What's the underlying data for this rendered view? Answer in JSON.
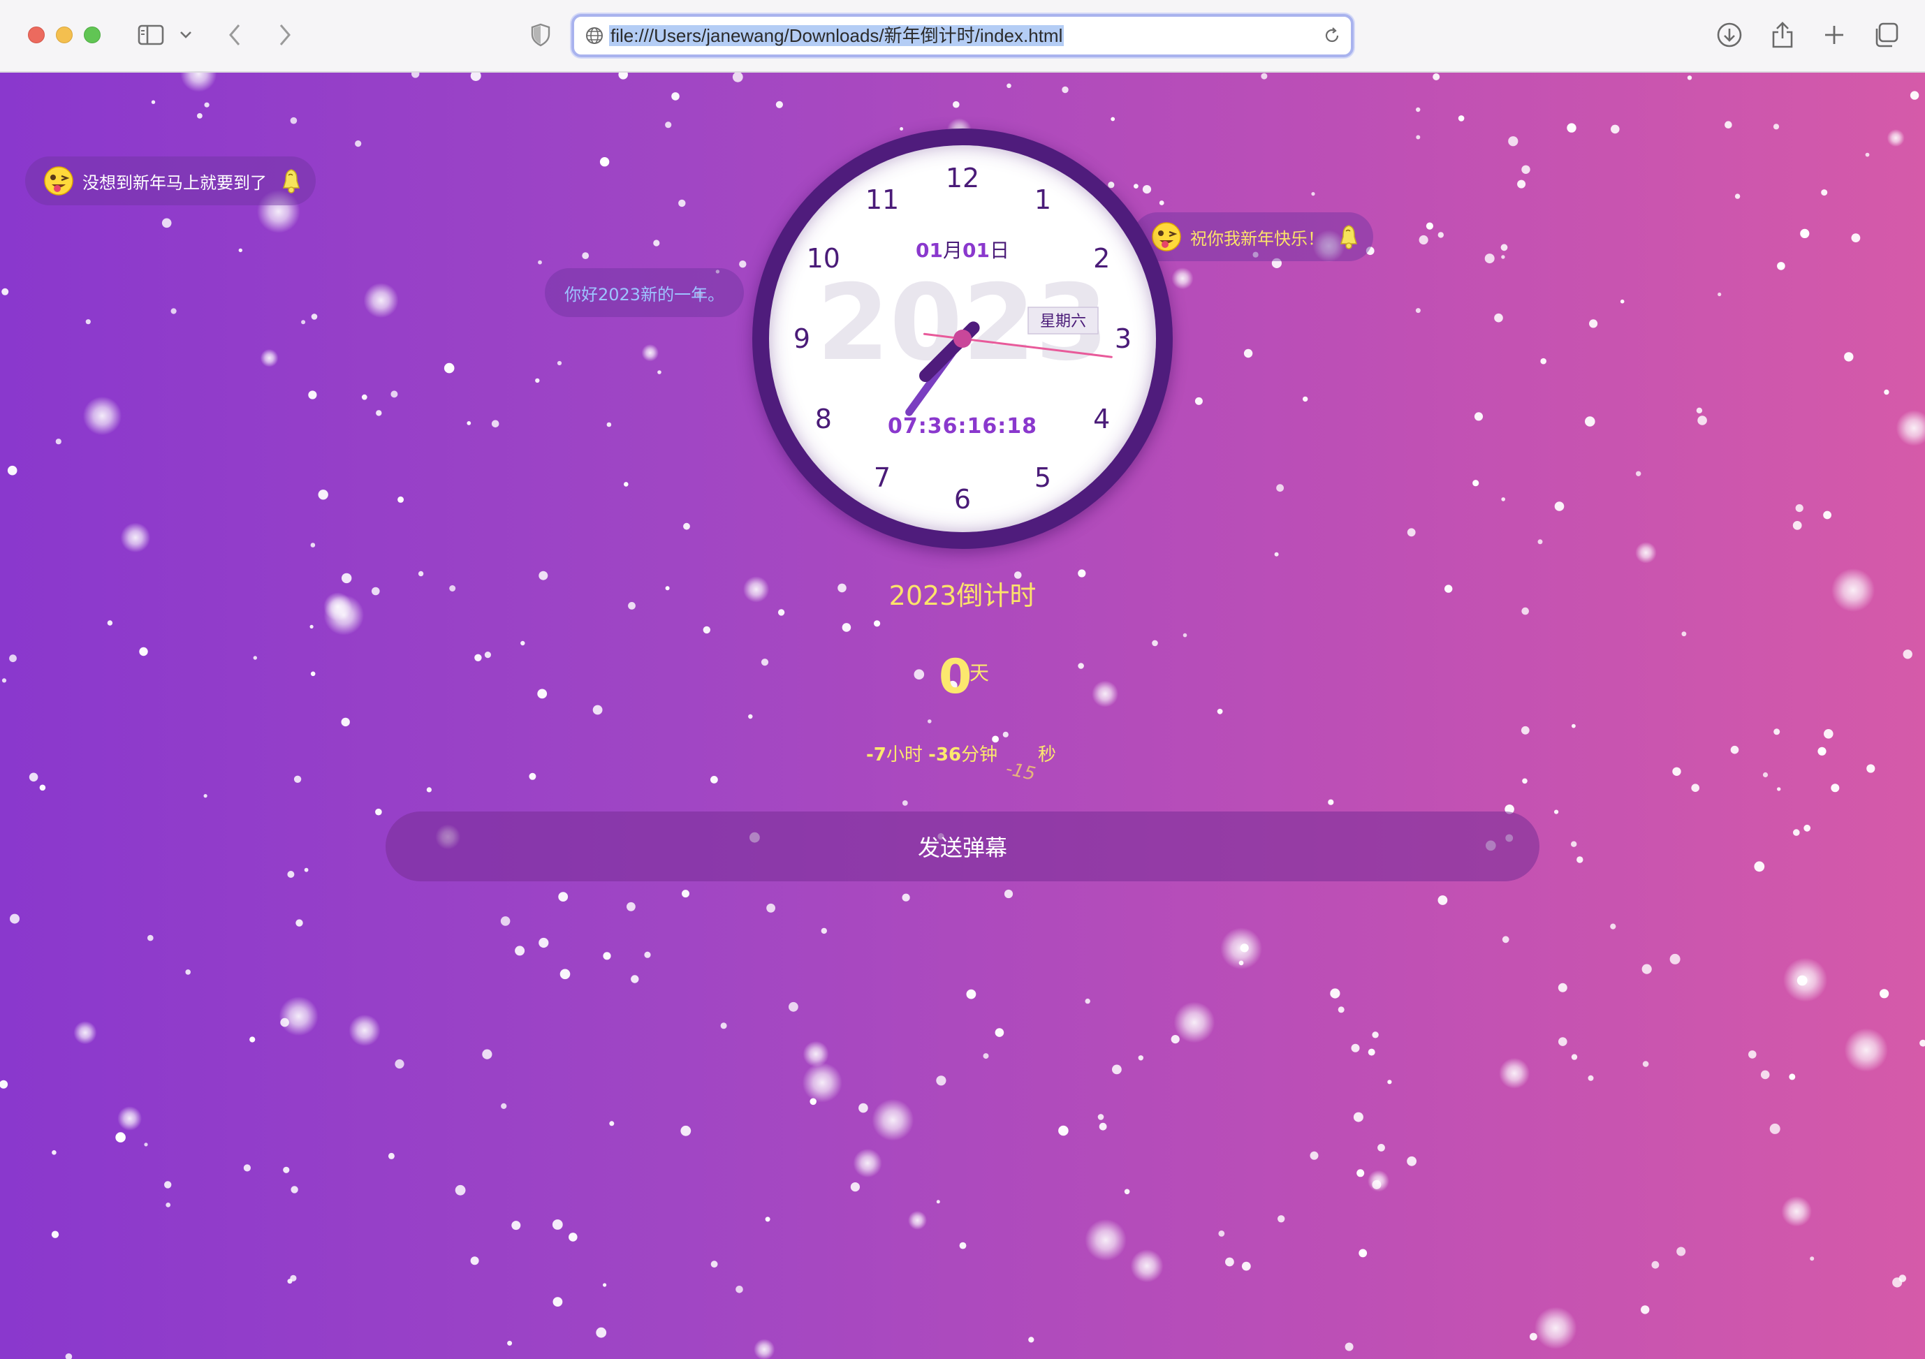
{
  "browser": {
    "url": "file:///Users/janewang/Downloads/新年倒计时/index.html"
  },
  "danmaku": [
    {
      "text": "没想到新年马上就要到了",
      "color": "#ffffff"
    },
    {
      "text": "你好2023新的一年。",
      "color": "#9ec3ff"
    },
    {
      "text": "祝你我新年快乐！",
      "color": "#fce36a"
    }
  ],
  "clock": {
    "numbers": [
      "12",
      "1",
      "2",
      "3",
      "4",
      "5",
      "6",
      "7",
      "8",
      "9",
      "10",
      "11"
    ],
    "date_month": "01",
    "date_month_unit": "月",
    "date_day": "01",
    "date_day_unit": "日",
    "year_watermark": "2023",
    "weekday": "星期六",
    "digital_time": "07:36:16:18",
    "hand_hour_deg": 228,
    "hand_minute_deg": 216,
    "hand_second_deg": 97
  },
  "countdown": {
    "title": "2023倒计时",
    "days_value": "0",
    "days_unit": "天",
    "hours_value": "-7",
    "hours_unit": "小时",
    "minutes_value": "-36",
    "minutes_unit": "分钟",
    "seconds_value": "-15",
    "seconds_unit": "秒"
  },
  "send_button": {
    "label": "发送弹幕"
  },
  "colors": {
    "gradient_start": "#8a38cd",
    "gradient_end": "#d55aa9",
    "accent_yellow": "#fce86e",
    "clock_ring": "#4f1c7c",
    "clock_number": "#4a1b78",
    "clock_hand": "#6b2fa8",
    "second_hand": "#e85a9a"
  }
}
